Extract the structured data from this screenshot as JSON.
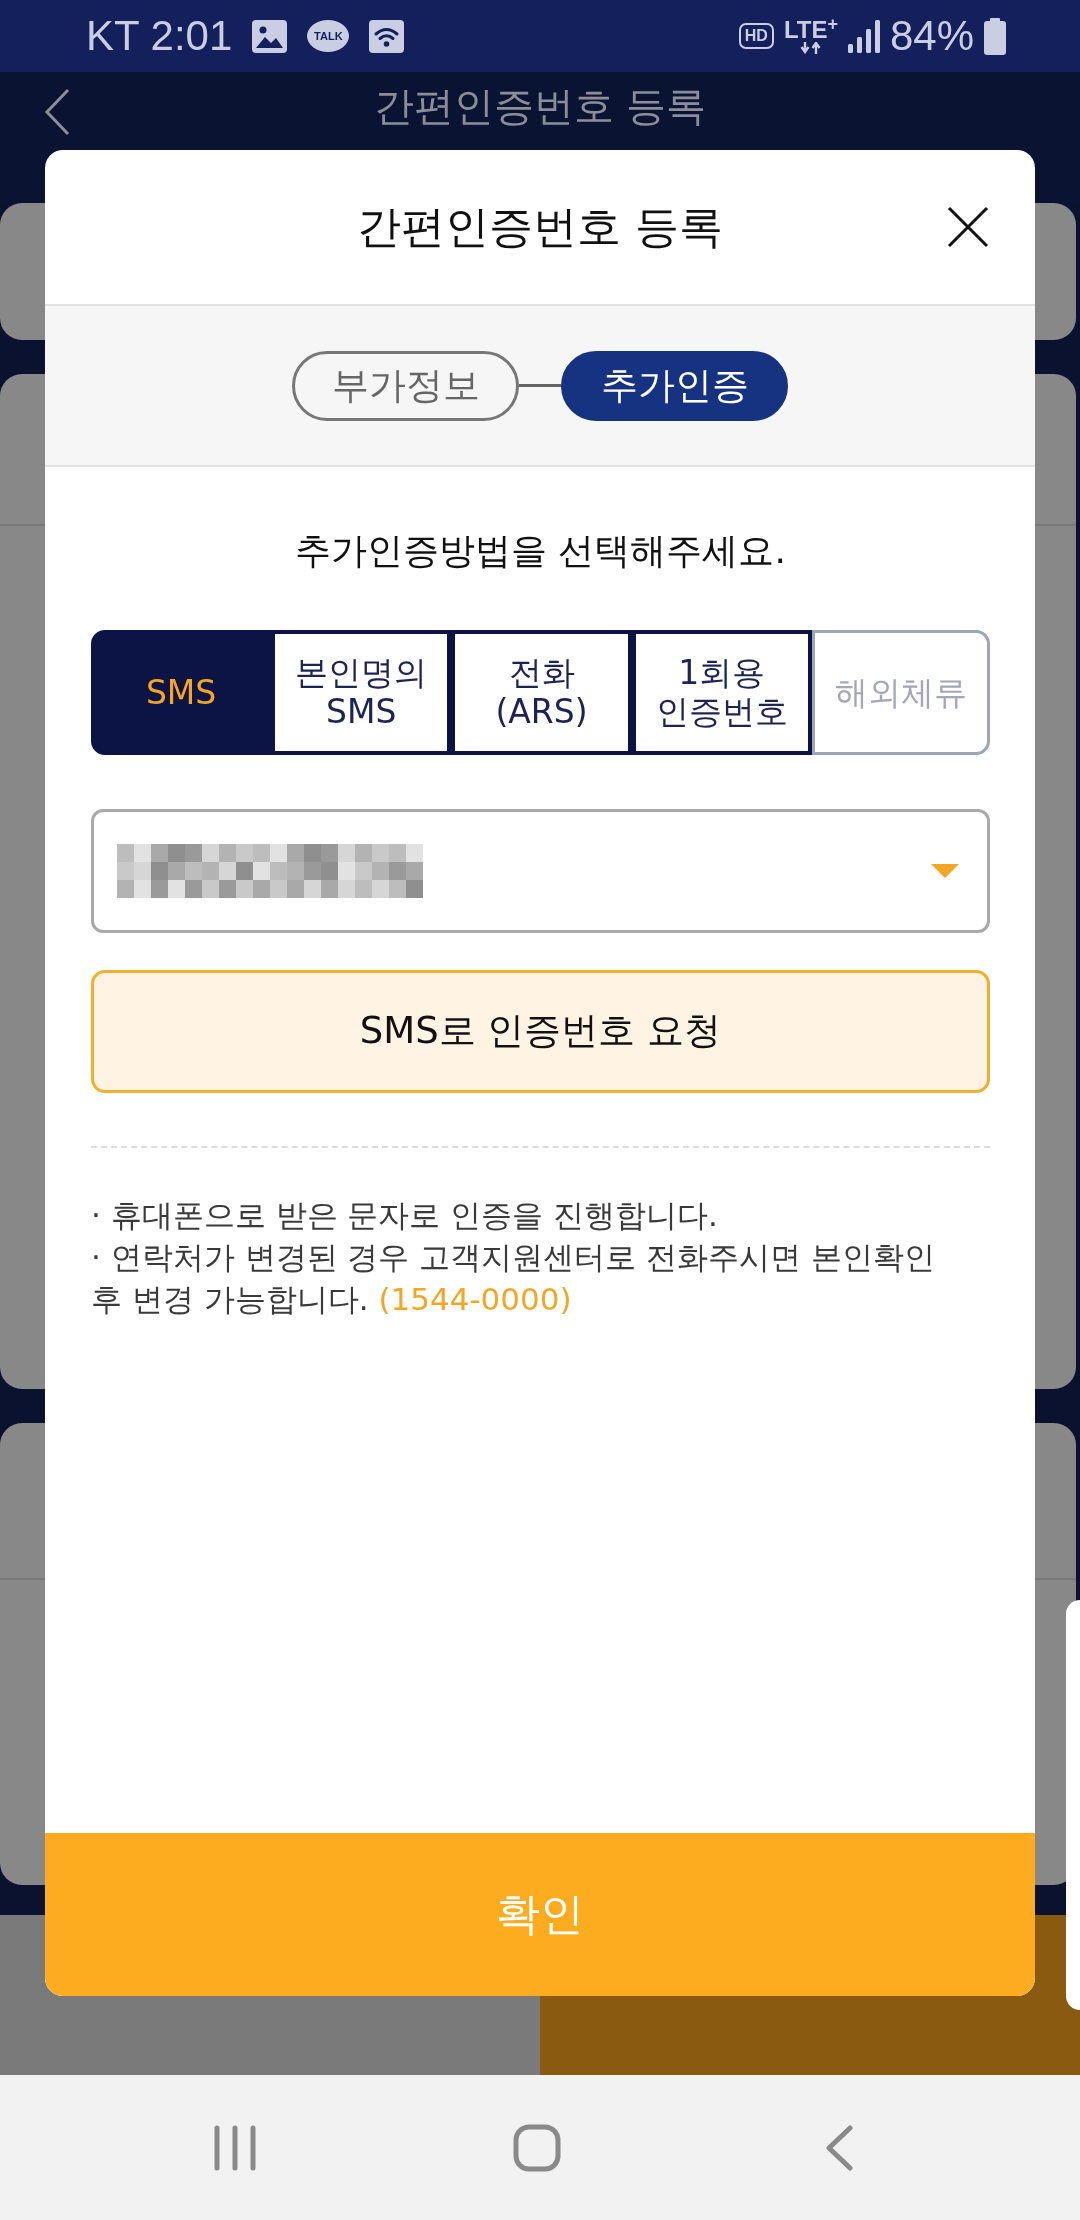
{
  "status_bar": {
    "carrier_time": "KT 2:01",
    "chat_badge": "TALK",
    "hd_badge": "HD",
    "network": "LTE$^{+}$",
    "battery": "84%"
  },
  "app_bar": {
    "title": "간편인증번호 등록"
  },
  "dialog": {
    "title": "간편인증번호 등록",
    "steps": [
      {
        "label": "부가정보",
        "selected": false
      },
      {
        "label": "추가인증",
        "selected": true
      }
    ],
    "prompt": "추가인증방법을 선택해주세요.",
    "methods": [
      {
        "label": "SMS",
        "selected": true,
        "disabled": false
      },
      {
        "label": "본인명의\nSMS",
        "selected": false,
        "disabled": false
      },
      {
        "label": "전화\n(ARS)",
        "selected": false,
        "disabled": false
      },
      {
        "label": "1회용\n인증번호",
        "selected": false,
        "disabled": false
      },
      {
        "label": "해외체류",
        "selected": false,
        "disabled": true
      }
    ],
    "phone_select": {
      "value_redacted": true
    },
    "request_button": "SMS로 인증번호 요청",
    "notes": [
      {
        "text": "· 휴대폰으로 받은 문자로 인증을 진행합니다."
      },
      {
        "text": "· 연락처가 변경된 경우 고객지원센터로 전화주시면 본인확인 후 변경 가능합니다.",
        "phone": "(1544-0000)"
      }
    ],
    "confirm_button": "확인"
  }
}
